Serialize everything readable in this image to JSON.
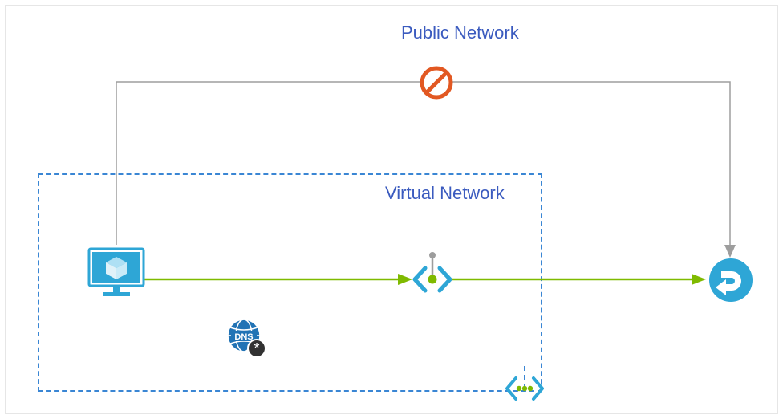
{
  "labels": {
    "public_network": "Public Network",
    "virtual_network": "Virtual Network"
  },
  "icons": {
    "vm": "virtual-machine-icon",
    "dns": "dns-icon",
    "private_endpoint": "private-endpoint-icon",
    "vnet_peering": "vnet-peering-connector-icon",
    "blocked": "blocked-icon",
    "relay": "azure-relay-icon"
  },
  "colors": {
    "azure_blue": "#2EA6D6",
    "azure_dark_blue": "#1d6ba1",
    "label_blue": "#3b5bbf",
    "dash_blue": "#3a86d4",
    "green": "#7fba00",
    "orange": "#e25822",
    "gray": "#9d9d9d",
    "star_bg": "#323232"
  }
}
